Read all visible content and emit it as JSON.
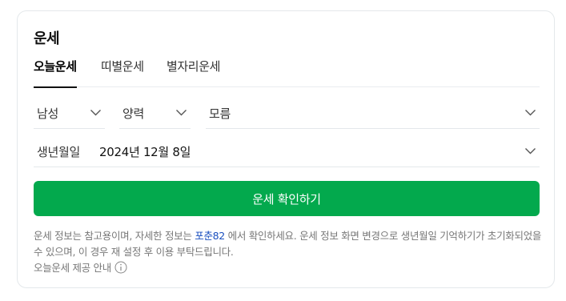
{
  "widget": {
    "title": "운세",
    "tabs": [
      {
        "label": "오늘운세",
        "active": true
      },
      {
        "label": "띠별운세",
        "active": false
      },
      {
        "label": "별자리운세",
        "active": false
      }
    ],
    "selects": {
      "gender": "남성",
      "calendar": "양력",
      "birth_time": "모름"
    },
    "birth": {
      "label": "생년월일",
      "value": "2024년 12월 8일"
    },
    "submit_label": "운세 확인하기",
    "notice": {
      "part1": "운세 정보는 참고용이며, 자세한 정보는 ",
      "link": "포춘82",
      "part2": " 에서 확인하세요. 운세 정보 화면 변경으로 생년월일 기억하기가 초기화되었을 수 있으며, 이 경우 재 설정 후 이용 부탁드립니다."
    },
    "info_link": "오늘운세 제공 안내",
    "colors": {
      "accent": "#03a94d",
      "link": "#1a4fbf"
    }
  }
}
